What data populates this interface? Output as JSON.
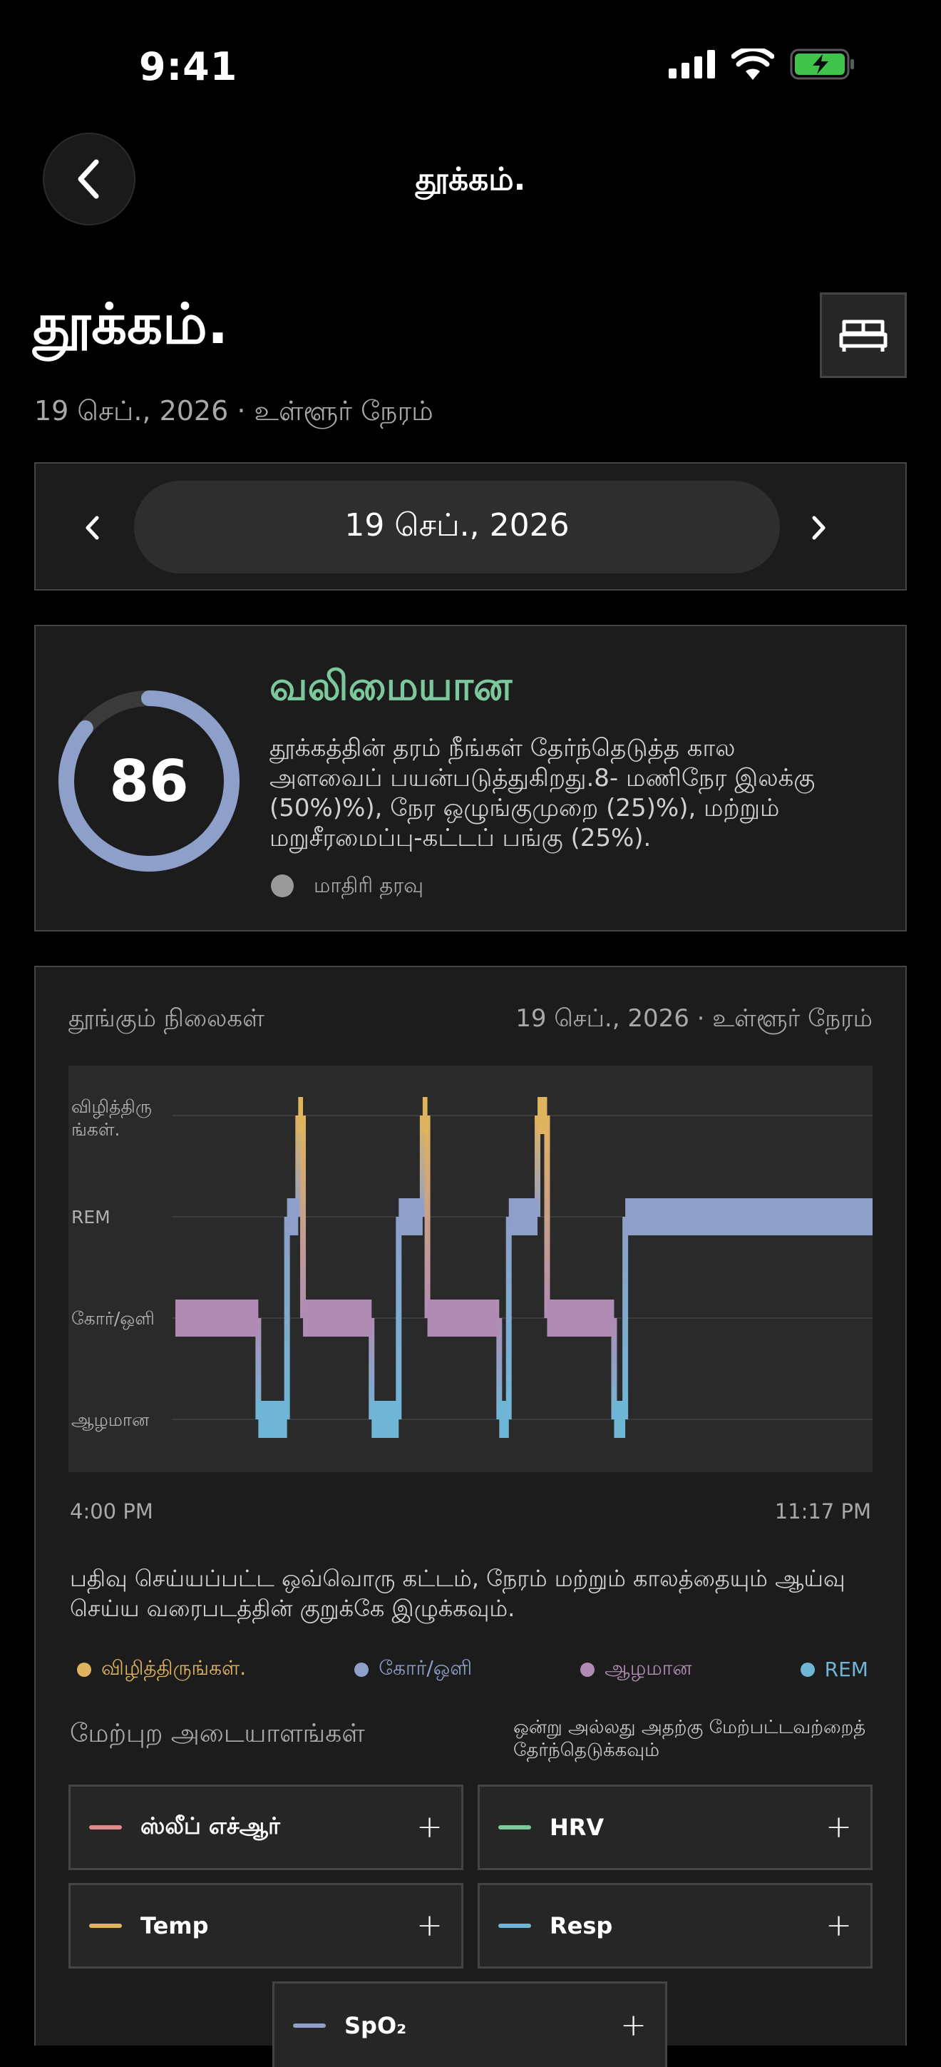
{
  "status_bar": {
    "time": "9:41"
  },
  "nav": {
    "title": "தூக்கம்."
  },
  "header": {
    "title": "தூக்கம்.",
    "subtitle": "19 செப்., 2026 · உள்ளூர் நேரம்"
  },
  "date_nav": {
    "date": "19 செப்., 2026"
  },
  "score_card": {
    "score": 86,
    "label": "வலிமையான",
    "description": "தூக்கத்தின் தரம் நீங்கள் தேர்ந்தெடுத்த கால அளவைப் பயன்படுத்துகிறது.8- மணிநேர இலக்கு (50%)%), நேர ஒழுங்குமுறை (25)%), மற்றும் மறுசீரமைப்பு-கட்டப் பங்கு (25%).",
    "source": "மாதிரி தரவு",
    "ring_color": "#8e9fc9",
    "label_color": "#7cc79c"
  },
  "stages": {
    "title": "தூங்கும் நிலைகள்",
    "date": "19 செப்., 2026 · உள்ளூர் நேரம்",
    "start_time": "4:00 PM",
    "end_time": "11:17 PM",
    "instruction": "பதிவு செய்யப்பட்ட ஒவ்வொரு கட்டம், நேரம் மற்றும் காலத்தையும் ஆய்வு செய்ய வரைபடத்தின் குறுக்கே இழுக்கவும்.",
    "legend": [
      {
        "label": "விழித்திருங்கள்.",
        "color": "#e0b45e"
      },
      {
        "label": "கோர்/ஒளி",
        "color": "#8e9fc9"
      },
      {
        "label": "ஆழமான",
        "color": "#b08cb4"
      },
      {
        "label": "REM",
        "color": "#6fb6d6"
      }
    ]
  },
  "chart_data": {
    "type": "area",
    "y_categories": [
      "விழித்திரு ங்கள்.",
      "REM",
      "கோர்/ஒளி",
      "ஆழமான"
    ],
    "x_start": "4:00 PM",
    "x_end": "11:17 PM",
    "x_range_min": [
      0,
      437
    ],
    "segments": [
      {
        "stage": "கோர்/ஒளி",
        "start": 0,
        "end": 52
      },
      {
        "stage": "ஆழமான",
        "start": 52,
        "end": 70
      },
      {
        "stage": "REM",
        "start": 70,
        "end": 77
      },
      {
        "stage": "விழித்திரு ங்கள்.",
        "start": 77,
        "end": 80
      },
      {
        "stage": "கோர்/ஒளி",
        "start": 80,
        "end": 123
      },
      {
        "stage": "ஆழமான",
        "start": 123,
        "end": 140
      },
      {
        "stage": "REM",
        "start": 140,
        "end": 155
      },
      {
        "stage": "விழித்திரு ங்கள்.",
        "start": 155,
        "end": 158
      },
      {
        "stage": "கோர்/ஒளி",
        "start": 158,
        "end": 203
      },
      {
        "stage": "ஆழமான",
        "start": 203,
        "end": 209
      },
      {
        "stage": "REM",
        "start": 209,
        "end": 227
      },
      {
        "stage": "விழித்திரு ங்கள்.",
        "start": 227,
        "end": 233
      },
      {
        "stage": "கோர்/ஒளி",
        "start": 233,
        "end": 275
      },
      {
        "stage": "ஆழமான",
        "start": 275,
        "end": 282
      },
      {
        "stage": "REM",
        "start": 282,
        "end": 437
      }
    ],
    "grid": true
  },
  "overlays": {
    "title": "மேற்புற அடையாளங்கள்",
    "hint": "ஒன்று அல்லது அதற்கு மேற்பட்டவற்றைத் தேர்ந்தெடுக்கவும்",
    "buttons": [
      {
        "label": "ஸ்லீப் எச்ஆர்",
        "color": "#e08a8e"
      },
      {
        "label": "HRV",
        "color": "#7cc79c"
      },
      {
        "label": "Temp",
        "color": "#e0b45e"
      },
      {
        "label": "Resp",
        "color": "#6fb6d6"
      },
      {
        "label": "SpO₂",
        "color": "#8e9fc9"
      }
    ],
    "plus": "+"
  }
}
